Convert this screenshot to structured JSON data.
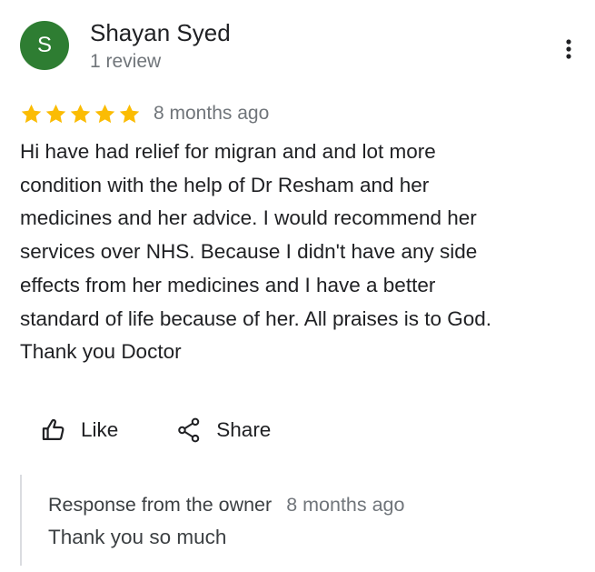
{
  "author": {
    "initial": "S",
    "name": "Shayan Syed",
    "meta": "1 review",
    "avatar_color": "#2e7d32"
  },
  "review": {
    "rating": 5,
    "max_rating": 5,
    "star_color": "#fbbc04",
    "time": "8 months ago",
    "text": "Hi have had relief for migran and and lot more\ncondition with the help of Dr Resham and her\nmedicines and her advice. I would recommend her\nservices over NHS. Because I didn't have any side\neffects from her medicines and I have a better\nstandard of life because of her. All praises is to God.\nThank you Doctor"
  },
  "actions": {
    "like_label": "Like",
    "like_icon": "thumbs-up-icon",
    "share_label": "Share",
    "share_icon": "share-icon"
  },
  "menu": {
    "icon": "more-vert-icon"
  },
  "owner_response": {
    "title": "Response from the owner",
    "time": "8 months ago",
    "text": "Thank you so much"
  }
}
